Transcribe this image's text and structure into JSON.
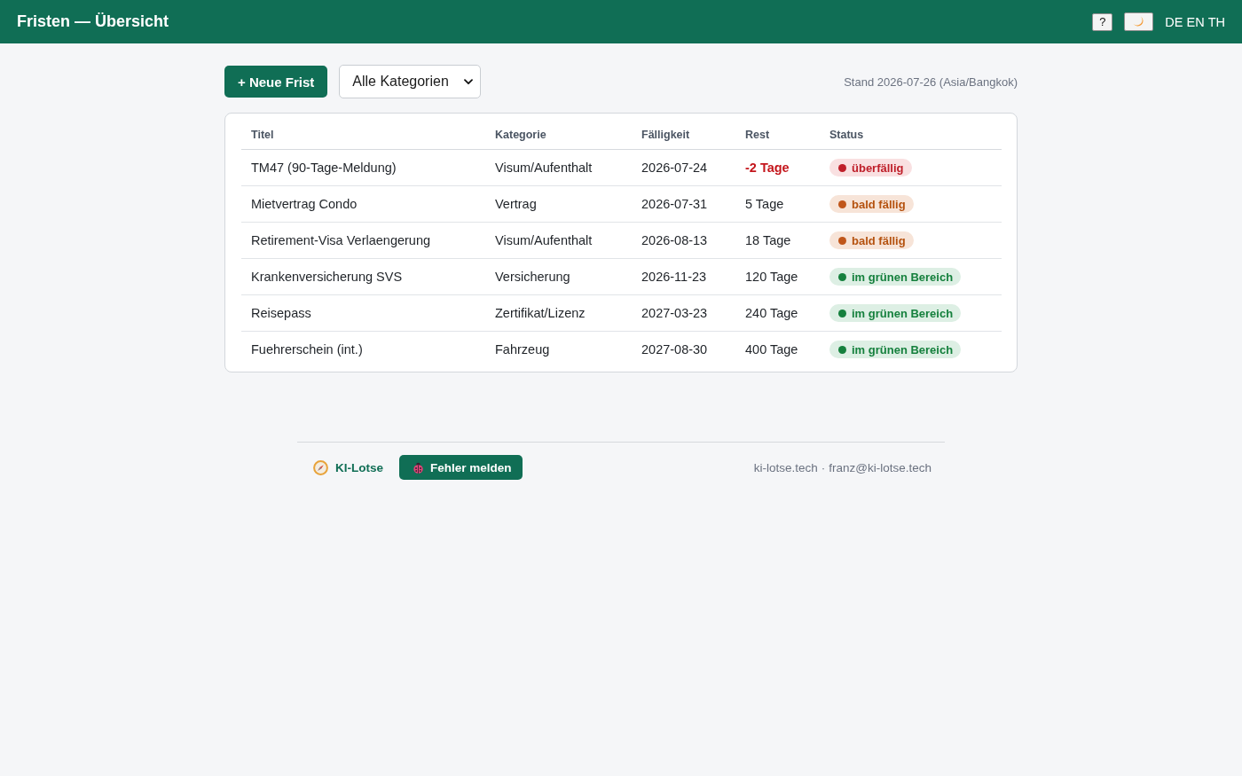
{
  "header": {
    "title": "Fristen — Übersicht",
    "help_button": "?",
    "languages": [
      {
        "label": "DE"
      },
      {
        "label": "EN"
      },
      {
        "label": "TH"
      }
    ]
  },
  "toolbar": {
    "new_button": "+ Neue Frist",
    "category_filter": {
      "value": "Alle Kategorien"
    },
    "as_of": "Stand 2026-07-26 (Asia/Bangkok)"
  },
  "table": {
    "columns": [
      "Titel",
      "Kategorie",
      "Fälligkeit",
      "Rest",
      "Status"
    ],
    "rows": [
      {
        "title": "TM47 (90-Tage-Meldung)",
        "category": "Visum/Aufenthalt",
        "due": "2026-07-24",
        "remaining": "-2 Tage",
        "status": {
          "label": "überfällig",
          "kind": "overdue"
        }
      },
      {
        "title": "Mietvertrag Condo",
        "category": "Vertrag",
        "due": "2026-07-31",
        "remaining": "5 Tage",
        "status": {
          "label": "bald fällig",
          "kind": "soon"
        }
      },
      {
        "title": "Retirement-Visa Verlaengerung",
        "category": "Visum/Aufenthalt",
        "due": "2026-08-13",
        "remaining": "18 Tage",
        "status": {
          "label": "bald fällig",
          "kind": "soon"
        }
      },
      {
        "title": "Krankenversicherung SVS",
        "category": "Versicherung",
        "due": "2026-11-23",
        "remaining": "120 Tage",
        "status": {
          "label": "im grünen Bereich",
          "kind": "ok"
        }
      },
      {
        "title": "Reisepass",
        "category": "Zertifikat/Lizenz",
        "due": "2027-03-23",
        "remaining": "240 Tage",
        "status": {
          "label": "im grünen Bereich",
          "kind": "ok"
        }
      },
      {
        "title": "Fuehrerschein (int.)",
        "category": "Fahrzeug",
        "due": "2027-08-30",
        "remaining": "400 Tage",
        "status": {
          "label": "im grünen Bereich",
          "kind": "ok"
        }
      }
    ]
  },
  "footer": {
    "brand": "KI-Lotse",
    "report_button": "Fehler melden",
    "site": "ki-lotse.tech",
    "separator": "·",
    "email": "franz@ki-lotse.tech"
  }
}
